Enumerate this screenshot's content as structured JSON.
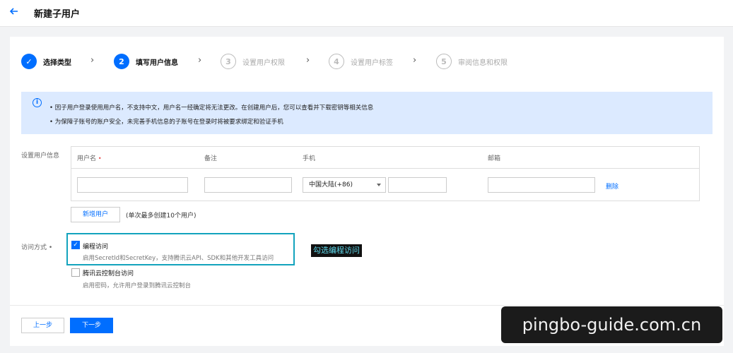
{
  "header": {
    "back_icon": "arrow-left-icon",
    "title": "新建子用户"
  },
  "steps": [
    {
      "number": "✓",
      "label": "选择类型",
      "state": "done"
    },
    {
      "number": "2",
      "label": "填写用户信息",
      "state": "active"
    },
    {
      "number": "3",
      "label": "设置用户权限",
      "state": "todo"
    },
    {
      "number": "4",
      "label": "设置用户标签",
      "state": "todo"
    },
    {
      "number": "5",
      "label": "审阅信息和权限",
      "state": "todo"
    }
  ],
  "notice": {
    "icon": "info-icon",
    "lines": [
      "• 因子用户登录使用用户名，不支持中文，用户名一经确定将无法更改。在创建用户后，您可以查看并下载密钥等相关信息",
      "• 为保障子账号的账户安全，未完善手机信息的子账号在登录时将被要求绑定和验证手机"
    ]
  },
  "user_info": {
    "section_label": "设置用户信息",
    "columns": {
      "username": "用户名",
      "required_mark": "•",
      "remark": "备注",
      "phone": "手机",
      "email": "邮箱"
    },
    "row": {
      "username": "",
      "remark": "",
      "country_code": "中国大陆(+86)",
      "phone": "",
      "email": "",
      "delete_label": "删除"
    },
    "add_user_label": "新增用户",
    "add_hint": "(单次最多创建10个用户)"
  },
  "access": {
    "section_label": "访问方式 •",
    "options": [
      {
        "title": "编程访问",
        "desc": "启用SecretId和SecretKey，支持腾讯云API、SDK和其他开发工具访问",
        "checked": true
      },
      {
        "title": "腾讯云控制台访问",
        "desc": "启用密码，允许用户登录到腾讯云控制台",
        "checked": false
      }
    ],
    "callout": "勾选编程访问"
  },
  "footer": {
    "prev_label": "上一步",
    "next_label": "下一步"
  },
  "watermark": "pingbo-guide.com.cn",
  "colors": {
    "primary": "#006eff",
    "notice_bg": "#dceaff",
    "highlight_border": "#13a3bd",
    "callout_text": "#5fd7ea",
    "required": "#e54545"
  }
}
